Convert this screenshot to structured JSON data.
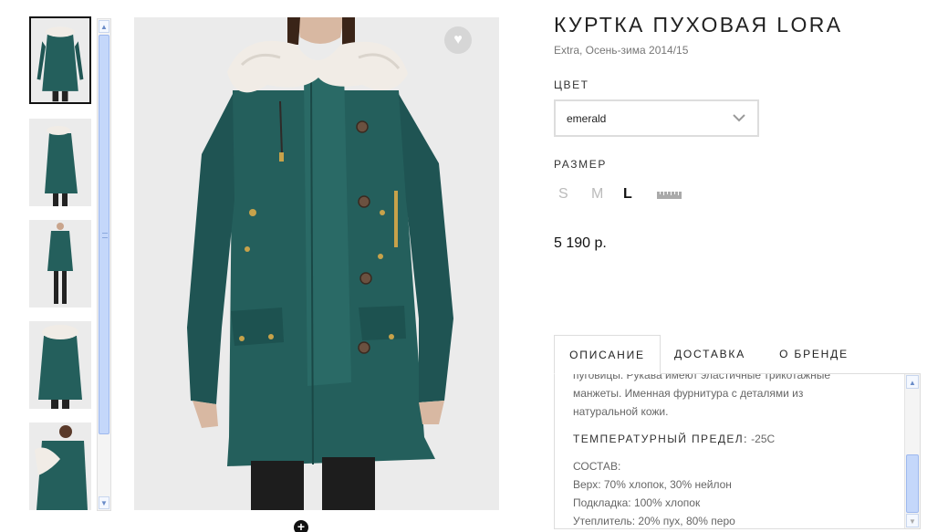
{
  "product": {
    "title": "КУРТКА ПУХОВАЯ LORA",
    "subtitle": "Extra, Осень-зима 2014/15",
    "price": "5 190 р."
  },
  "color": {
    "label": "ЦВЕТ",
    "selected": "emerald"
  },
  "size": {
    "label": "РАЗМЕР",
    "options": [
      "S",
      "M",
      "L"
    ],
    "selected": "L"
  },
  "tabs": [
    "ОПИСАНИЕ",
    "ДОСТАВКА",
    "О БРЕНДЕ"
  ],
  "description": {
    "text_cut": "пуговицы. Рукава имеют эластичные трикотажные",
    "text_1": "манжеты. Именная фурнитура с деталями из",
    "text_2": "натуральной кожи.",
    "temp_label": "ТЕМПЕРАТУРНЫЙ ПРЕДЕЛ:",
    "temp_value": "-25C",
    "composition_label": "СОСТАВ:",
    "composition": [
      "Верх: 70% хлопок, 30% нейлон",
      "Подкладка: 100% хлопок",
      "Утеплитель: 20% пух, 80% перо"
    ]
  },
  "icons": {
    "favorite": "heart-icon",
    "zoom": "plus-circle-icon",
    "dropdown": "chevron-down-icon",
    "size_guide": "ruler-icon"
  },
  "colors": {
    "jacket": "#245f5c",
    "fur": "#f1ece6",
    "background": "#ebebeb"
  }
}
